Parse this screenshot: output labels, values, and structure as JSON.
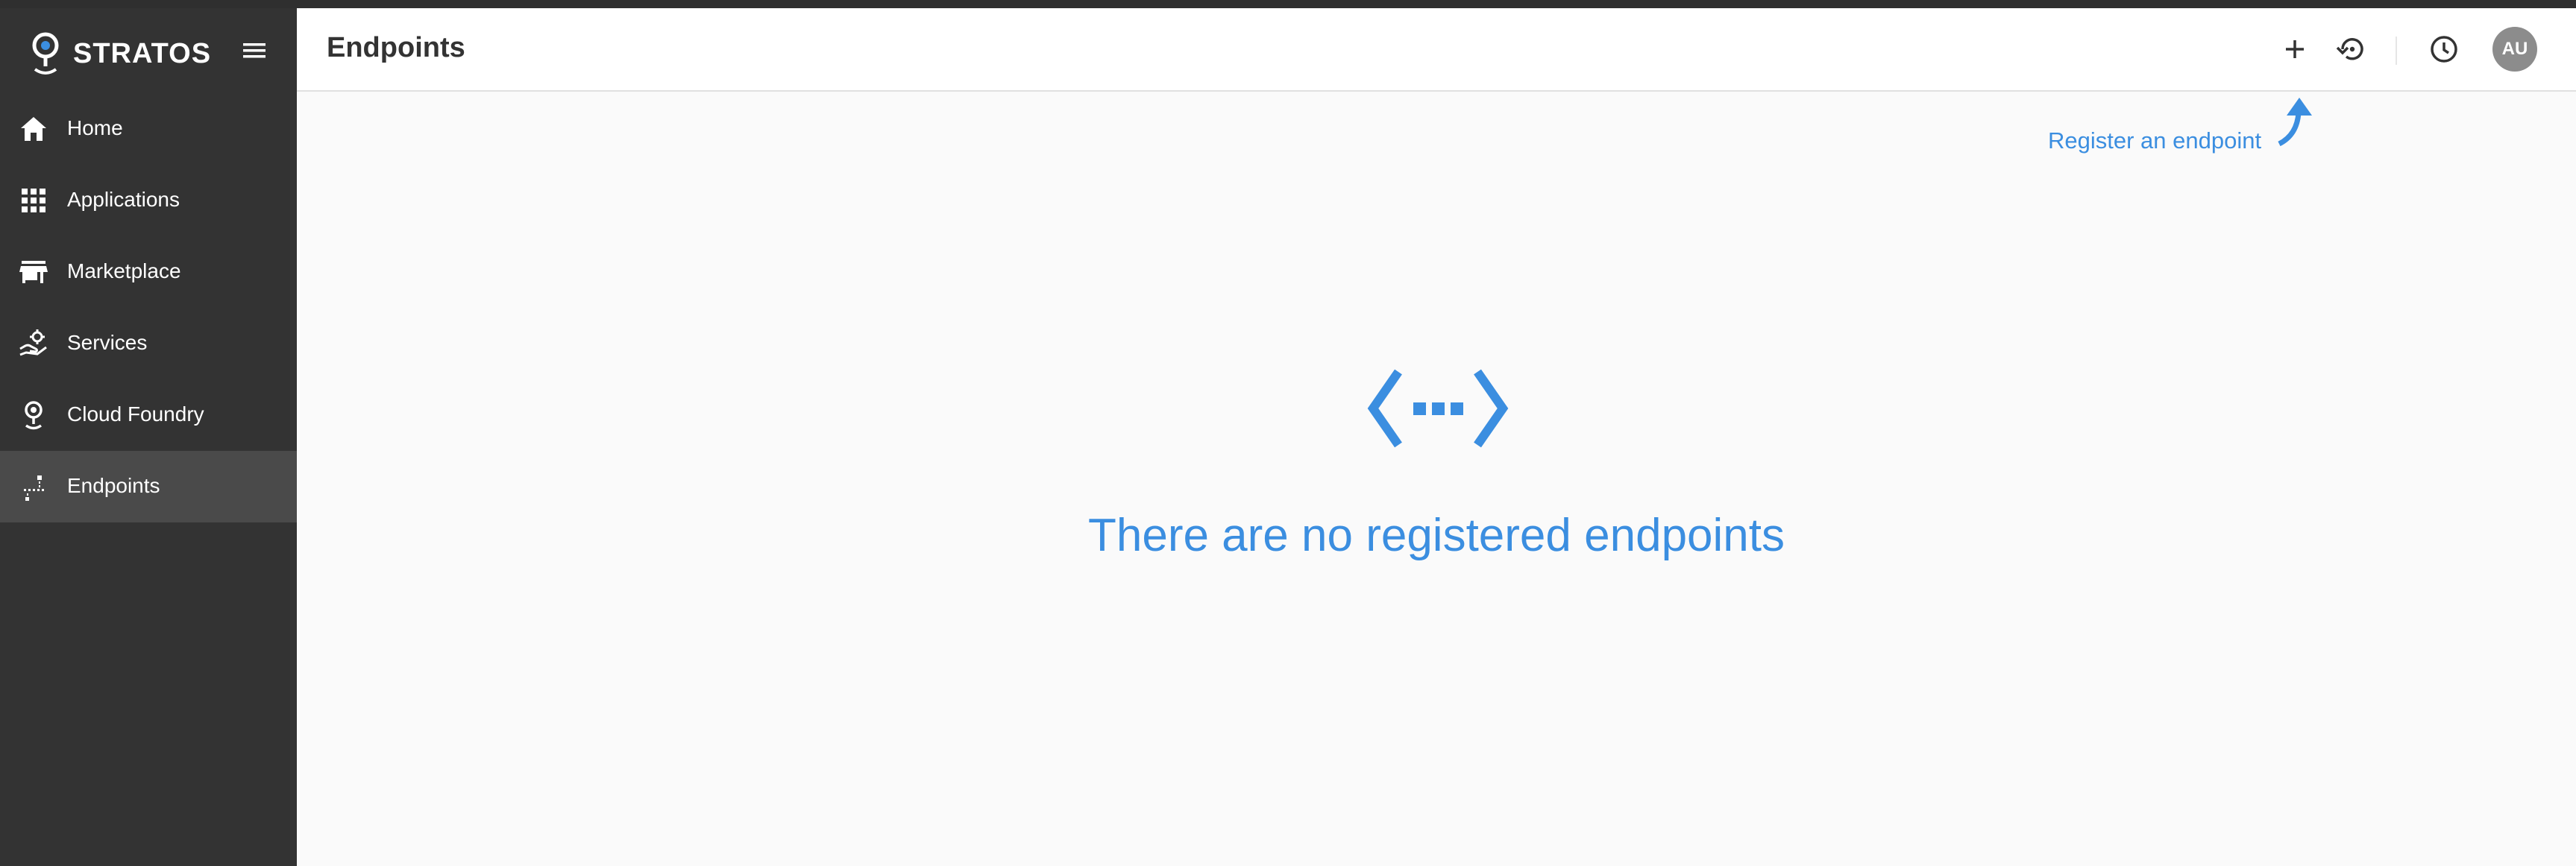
{
  "app": {
    "brand": "STRATOS"
  },
  "sidebar": {
    "items": [
      {
        "label": "Home",
        "icon": "home-icon",
        "active": false
      },
      {
        "label": "Applications",
        "icon": "apps-grid-icon",
        "active": false
      },
      {
        "label": "Marketplace",
        "icon": "store-icon",
        "active": false
      },
      {
        "label": "Services",
        "icon": "service-hand-icon",
        "active": false
      },
      {
        "label": "Cloud Foundry",
        "icon": "cloud-foundry-icon",
        "active": false
      },
      {
        "label": "Endpoints",
        "icon": "endpoints-icon",
        "active": true
      }
    ]
  },
  "header": {
    "title": "Endpoints",
    "avatar_initials": "AU",
    "icons": [
      "add-icon",
      "history-icon",
      "clock-icon"
    ]
  },
  "main": {
    "hint": "Register an endpoint",
    "empty_message": "There are no registered endpoints"
  },
  "colors": {
    "sidebar_bg": "#333333",
    "sidebar_active": "#4a4a4a",
    "accent": "#3b8ee0",
    "avatar_bg": "#8c8c8c"
  }
}
